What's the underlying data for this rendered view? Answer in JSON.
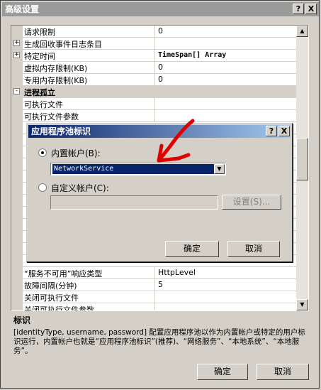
{
  "window": {
    "title": "高级设置",
    "help_button": "?",
    "close_button": "X"
  },
  "grid": {
    "rows": [
      {
        "name": "请求限制",
        "value": "0"
      },
      {
        "name": "生成回收事件日志条目",
        "value": "",
        "expander": "+"
      },
      {
        "name": "特定时间",
        "value": "TimeSpan[] Array",
        "expander": "+"
      },
      {
        "name": "虚拟内存限制(KB)",
        "value": "0"
      },
      {
        "name": "专用内存限制(KB)",
        "value": "0"
      },
      {
        "name": "进程孤立",
        "category": true,
        "expander": "-"
      },
      {
        "name": "可执行文件",
        "value": ""
      },
      {
        "name": "可执行文件参数",
        "value": ""
      },
      {
        "name": "“服务不可用”响应类型",
        "value": "HttpLevel"
      },
      {
        "name": "故障间隔(分钟)",
        "value": "5"
      },
      {
        "name": "关闭可执行文件",
        "value": ""
      },
      {
        "name": "关闭可执行文件参数",
        "value": ""
      }
    ]
  },
  "description": {
    "title": "标识",
    "text": "[identityType, username, password] 配置应用程序池以作为内置帐户或特定的用户标识运行，内置帐户也就是“应用程序池标识”(推荐)、“网络服务”、“本地系统”、“本地服务”。"
  },
  "buttons": {
    "ok": "确定",
    "cancel": "取消"
  },
  "dialog": {
    "title": "应用程序池标识",
    "help_button": "?",
    "close_button": "X",
    "builtin_label": "内置帐户(B):",
    "builtin_value": "NetworkService",
    "custom_label": "自定义帐户(C):",
    "custom_value": "",
    "settings_button": "设置(S)...",
    "ok": "确定",
    "cancel": "取消"
  }
}
